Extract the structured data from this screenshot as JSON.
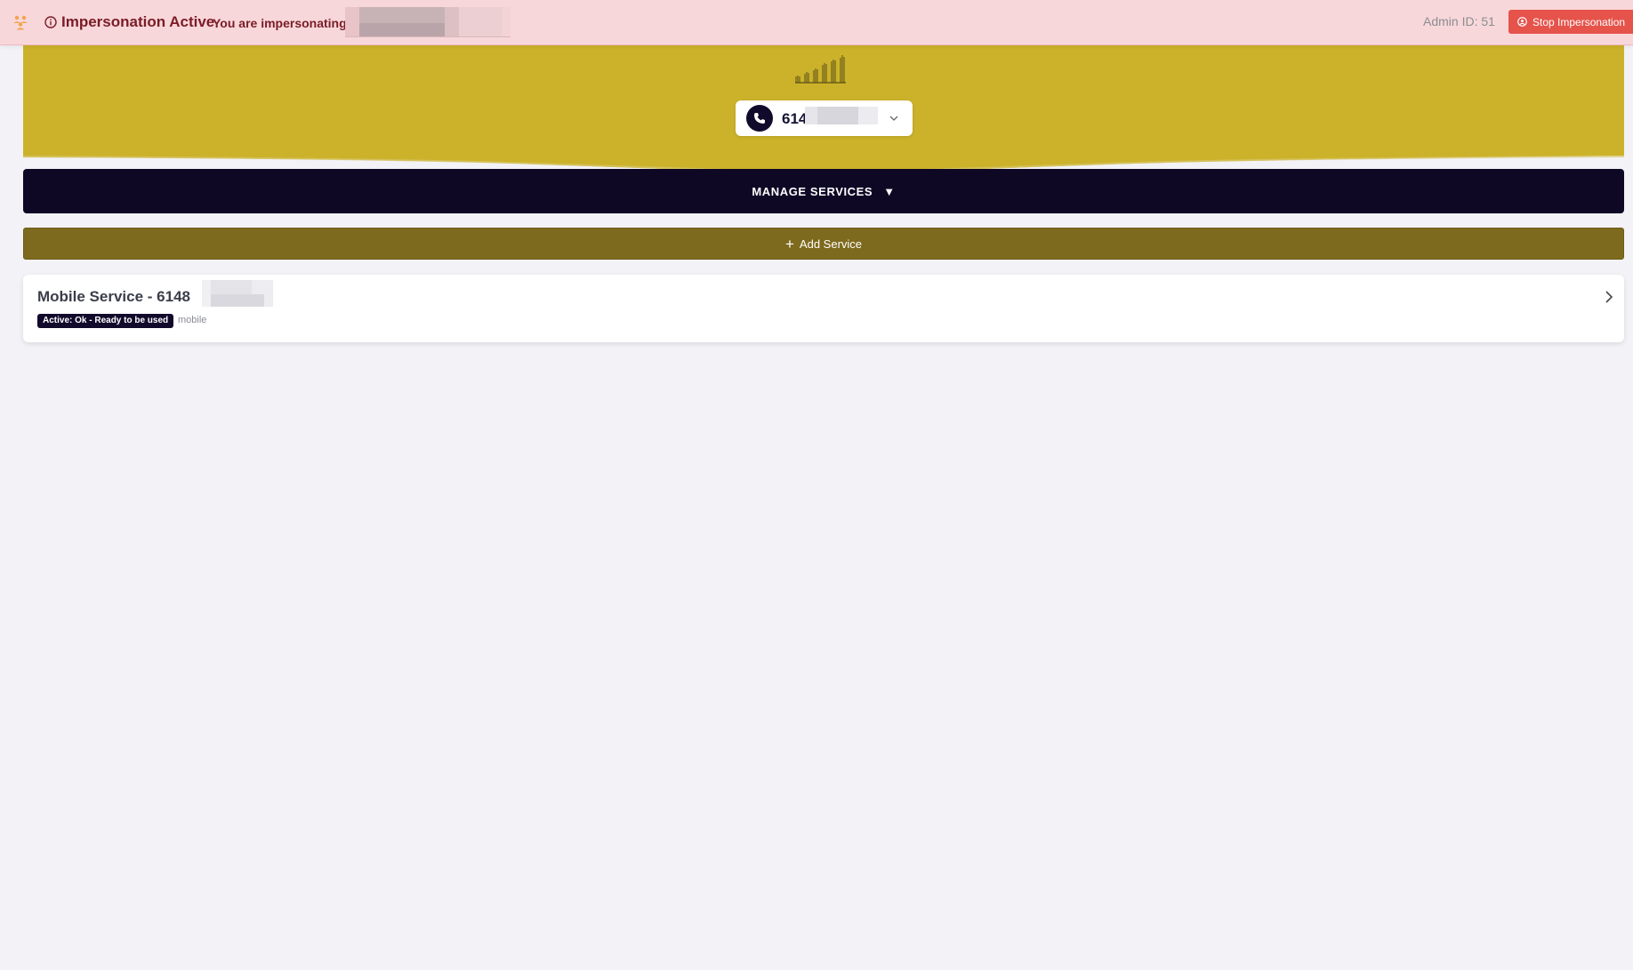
{
  "banner": {
    "title": "Impersonation Active",
    "message": "You are impersonating",
    "admin_id": "Admin ID: 51",
    "stop_label": "Stop Impersonation",
    "icon_users": "users-icon",
    "icon_info": "info-icon",
    "icon_stop": "user-circle-icon"
  },
  "header": {
    "logo": "signal-bars-logo",
    "phone_visible": "614",
    "phone_icon": "phone-icon",
    "dropdown_icon": "chevron-down-icon"
  },
  "manage": {
    "label": "MANAGE SERVICES",
    "arrow": "▼"
  },
  "add": {
    "plus": "+",
    "label": "Add Service"
  },
  "services": [
    {
      "title": "Mobile Service - 6148",
      "status": "Active: Ok - Ready to be used",
      "type": "mobile"
    }
  ],
  "colors": {
    "banner_bg": "#f8d7da",
    "banner_text": "#7a1c27",
    "stop_button": "#e5534b",
    "hero": "#cbb22a",
    "navy": "#0e0825",
    "add_bar": "#7e6a1e",
    "page_bg": "#f2f2f7"
  }
}
